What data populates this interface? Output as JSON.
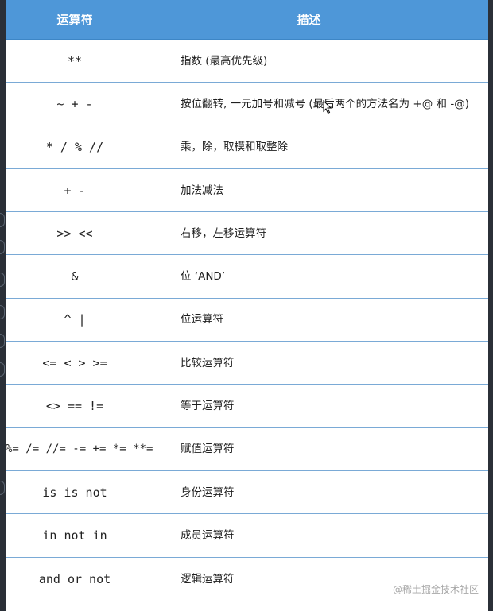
{
  "header": {
    "col_operator": "运算符",
    "col_description": "描述"
  },
  "rows": [
    {
      "op": "**",
      "desc": "指数 (最高优先级)"
    },
    {
      "op": "~ + -",
      "desc": "按位翻转, 一元加号和减号 (最后两个的方法名为 +@ 和 -@)"
    },
    {
      "op": "* / % //",
      "desc": "乘，除，取模和取整除"
    },
    {
      "op": "+ -",
      "desc": "加法减法"
    },
    {
      "op": ">> <<",
      "desc": "右移，左移运算符"
    },
    {
      "op": "&",
      "desc": "位 ‘AND’"
    },
    {
      "op": "^ |",
      "desc": "位运算符"
    },
    {
      "op": "<= < > >=",
      "desc": "比较运算符"
    },
    {
      "op": "<> == !=",
      "desc": "等于运算符"
    },
    {
      "op": "%= /= //= -= += *= **=",
      "desc": "赋值运算符"
    },
    {
      "op": "is is not",
      "desc": "身份运算符"
    },
    {
      "op": "in not in",
      "desc": "成员运算符"
    },
    {
      "op": "and or not",
      "desc": "逻辑运算符"
    }
  ],
  "watermark": "@稀土掘金技术社区"
}
